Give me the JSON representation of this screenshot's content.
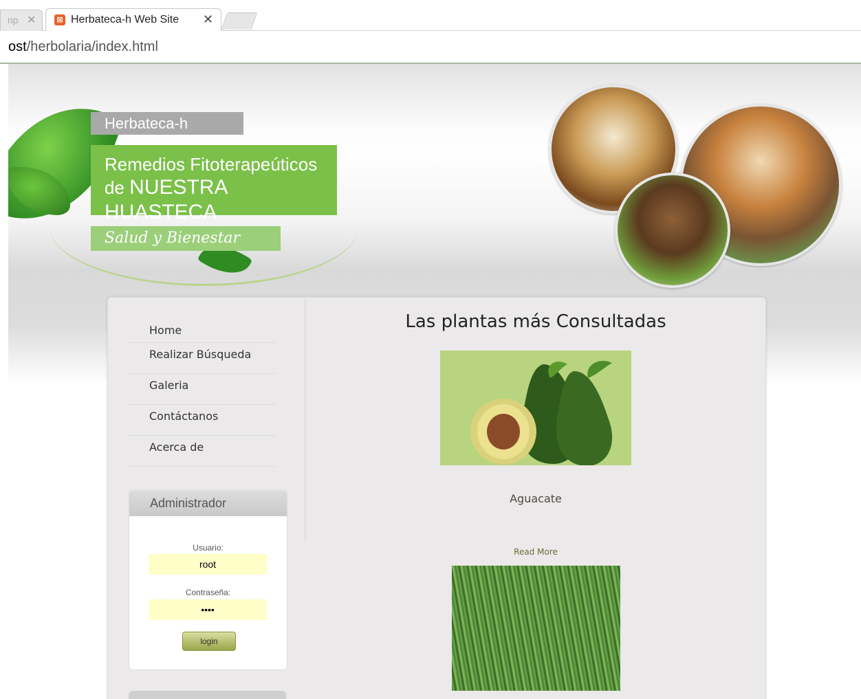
{
  "browser": {
    "prev_tab_label": "np",
    "active_tab": {
      "favicon": "xampp-icon",
      "title": "Herbateca-h Web Site"
    },
    "url": {
      "host": "ost",
      "path": "/herbolaria/index.html"
    }
  },
  "header": {
    "brand": "Herbateca-h",
    "tagline_line1": "Remedios  Fitoterapeúticos",
    "tagline_line2_prefix": "de",
    "tagline_line2_main": "NUESTRA HUASTECA",
    "slogan": "Salud y Bienestar"
  },
  "nav": {
    "items": [
      {
        "label": "Home"
      },
      {
        "label": "Realizar Búsqueda"
      },
      {
        "label": "Galeria"
      },
      {
        "label": "Contáctanos"
      },
      {
        "label": "Acerca de"
      }
    ]
  },
  "admin": {
    "title": "Administrador",
    "user_label": "Usuario:",
    "user_value": "root",
    "password_label": "Contraseña:",
    "password_value": "••••",
    "login_label": "login"
  },
  "main": {
    "title": "Las plantas más Consultadas",
    "plants": [
      {
        "name": "Aguacate",
        "read_more": "Read More",
        "image": "avocado"
      },
      {
        "image": "horsetail-plant"
      }
    ]
  }
}
